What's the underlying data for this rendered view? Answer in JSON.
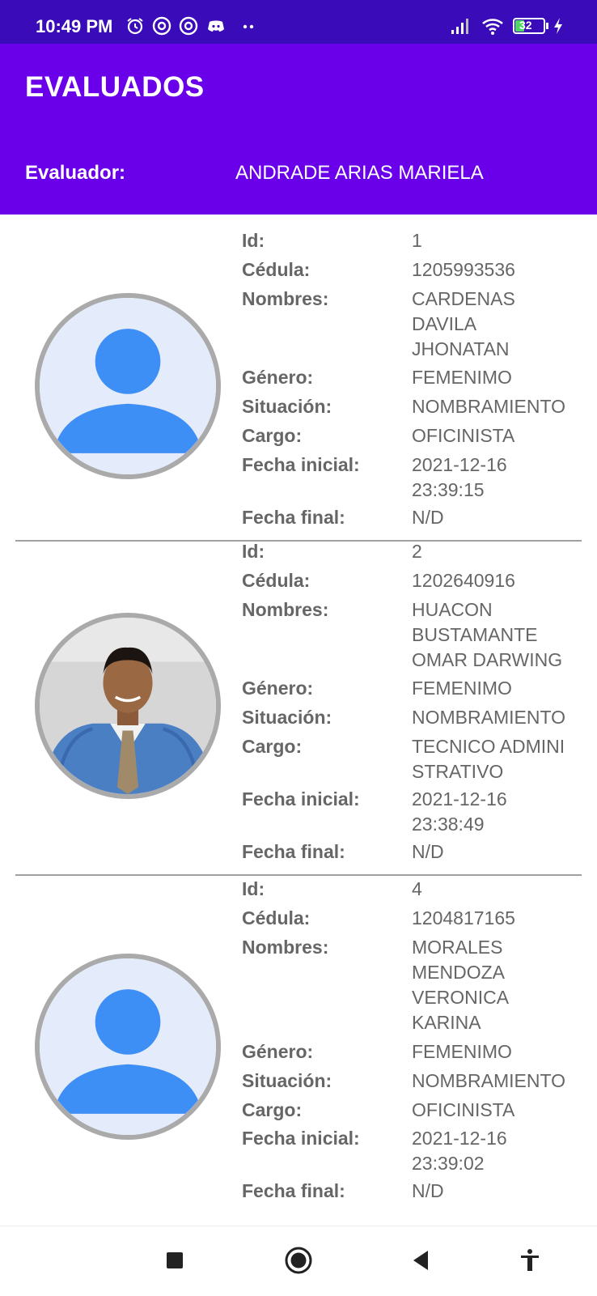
{
  "status_bar": {
    "time": "10:49 PM",
    "battery": "32",
    "icons": [
      "alarm-icon",
      "app-notification-icon",
      "app-notification-icon",
      "discord-icon",
      "more-icon",
      "signal-icon",
      "wifi-icon",
      "battery-icon",
      "charging-icon"
    ]
  },
  "app_bar": {
    "title": "EVALUADOS"
  },
  "evaluator": {
    "label": "Evaluador:",
    "name": "ANDRADE ARIAS MARIELA"
  },
  "field_labels": {
    "id": "Id:",
    "cedula": "Cédula:",
    "nombres": "Nombres:",
    "genero": "Género:",
    "situacion": "Situación:",
    "cargo": "Cargo:",
    "fecha_inicial": "Fecha inicial:",
    "fecha_final": "Fecha final:"
  },
  "evaluados": [
    {
      "avatar": "default-avatar-icon",
      "id": "1",
      "cedula": "1205993536",
      "nombres": "CARDENAS\nDAVILA\nJHONATAN",
      "genero": "FEMENIMO",
      "situacion": "NOMBRAMIENTO",
      "cargo": "OFICINISTA",
      "fecha_inicial": "2021-12-16\n23:39:15",
      "fecha_final": "N/D"
    },
    {
      "avatar": "profile-photo",
      "id": "2",
      "cedula": "1202640916",
      "nombres": "HUACON\nBUSTAMANTE\nOMAR DARWING",
      "genero": "FEMENIMO",
      "situacion": "NOMBRAMIENTO",
      "cargo": "TECNICO ADMINI\nSTRATIVO",
      "fecha_inicial": "2021-12-16\n23:38:49",
      "fecha_final": "N/D"
    },
    {
      "avatar": "default-avatar-icon",
      "id": "4",
      "cedula": "1204817165",
      "nombres": "MORALES\nMENDOZA\nVERONICA\nKARINA",
      "genero": "FEMENIMO",
      "situacion": "NOMBRAMIENTO",
      "cargo": "OFICINISTA",
      "fecha_inicial": "2021-12-16\n23:39:02",
      "fecha_final": "N/D"
    }
  ],
  "nav_bar": {
    "buttons": [
      "recents-icon",
      "home-icon",
      "back-icon",
      "accessibility-icon"
    ]
  },
  "colors": {
    "status_bar": "#3a0bb8",
    "app_bar": "#6a00ea",
    "avatar_blue": "#3d8ef5",
    "avatar_bg": "#e4ecfb",
    "text": "#666666"
  }
}
